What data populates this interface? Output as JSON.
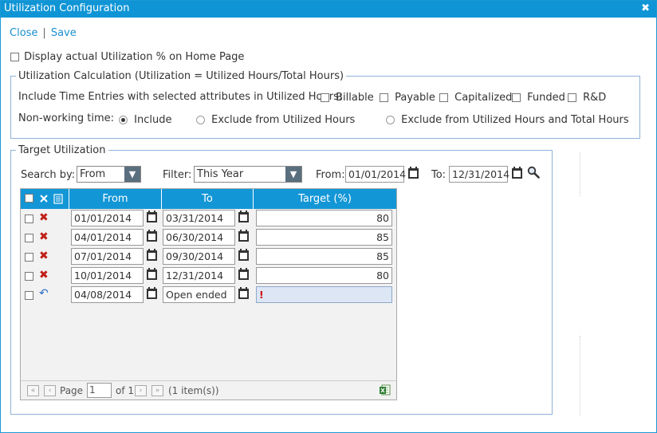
{
  "window": {
    "title": "Utilization Configuration",
    "close_glyph": "✖"
  },
  "links": {
    "close": "Close",
    "separator": "|",
    "save": "Save"
  },
  "display_option": {
    "label": "Display actual Utilization % on Home Page",
    "checked": false
  },
  "calc": {
    "legend": "Utilization Calculation (Utilization = Utilized Hours/Total Hours)",
    "include_label": "Include Time Entries with selected attributes in Utilized Hours:",
    "attributes": [
      {
        "label": "Billable",
        "checked": false
      },
      {
        "label": "Payable",
        "checked": false
      },
      {
        "label": "Capitalized",
        "checked": false
      },
      {
        "label": "Funded",
        "checked": false
      },
      {
        "label": "R&D",
        "checked": false
      }
    ],
    "nonworking_label": "Non-working time:",
    "nonworking_options": [
      {
        "label": "Include",
        "selected": true
      },
      {
        "label": "Exclude from Utilized Hours",
        "selected": false
      },
      {
        "label": "Exclude from Utilized Hours and Total Hours",
        "selected": false
      }
    ]
  },
  "target": {
    "legend": "Target Utilization",
    "search_by_label": "Search by:",
    "search_by_value": "From",
    "filter_label": "Filter:",
    "filter_value": "This Year",
    "from_label": "From:",
    "from_value": "01/01/2014",
    "to_label": "To:",
    "to_value": "12/31/2014",
    "columns": {
      "from": "From",
      "to": "To",
      "target": "Target (%)"
    },
    "rows": [
      {
        "from": "01/01/2014",
        "to": "03/31/2014",
        "target": "80",
        "action": "delete-icon"
      },
      {
        "from": "04/01/2014",
        "to": "06/30/2014",
        "target": "85",
        "action": "delete-icon"
      },
      {
        "from": "07/01/2014",
        "to": "09/30/2014",
        "target": "85",
        "action": "delete-icon"
      },
      {
        "from": "10/01/2014",
        "to": "12/31/2014",
        "target": "80",
        "action": "delete-icon"
      }
    ],
    "new_row": {
      "from": "04/08/2014",
      "to": "Open ended",
      "target": "",
      "error_mark": "!",
      "action": "undo-icon"
    },
    "pager": {
      "page_label": "Page",
      "page_value": "1",
      "of_label": "of 1",
      "items_label": "(1 item(s))"
    }
  },
  "colors": {
    "accent": "#0f95d6",
    "link": "#1a8fd0",
    "delete": "#c0201a",
    "new_row_bg": "#dce6f5",
    "fieldset_border": "#8fb3d9"
  }
}
